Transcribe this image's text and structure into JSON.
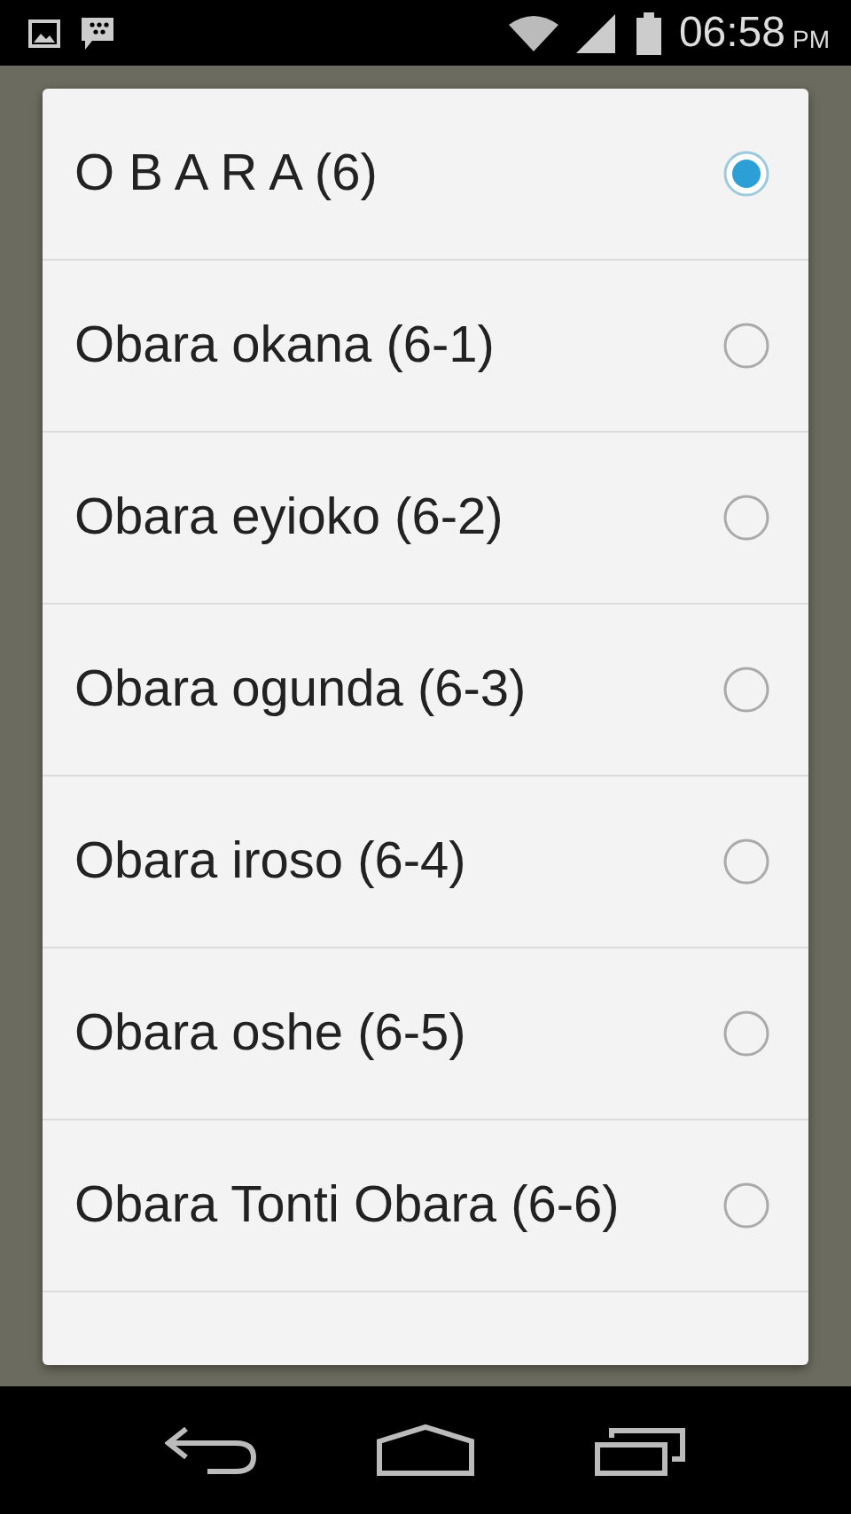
{
  "status_bar": {
    "time": "06:58",
    "ampm": "PM"
  },
  "dialog": {
    "options": [
      {
        "label": "O B A R A (6)",
        "selected": true
      },
      {
        "label": "Obara okana (6-1)",
        "selected": false
      },
      {
        "label": "Obara eyioko (6-2)",
        "selected": false
      },
      {
        "label": "Obara ogunda (6-3)",
        "selected": false
      },
      {
        "label": "Obara iroso (6-4)",
        "selected": false
      },
      {
        "label": "Obara oshe (6-5)",
        "selected": false
      },
      {
        "label": "Obara Tonti Obara (6-6)",
        "selected": false
      }
    ]
  }
}
